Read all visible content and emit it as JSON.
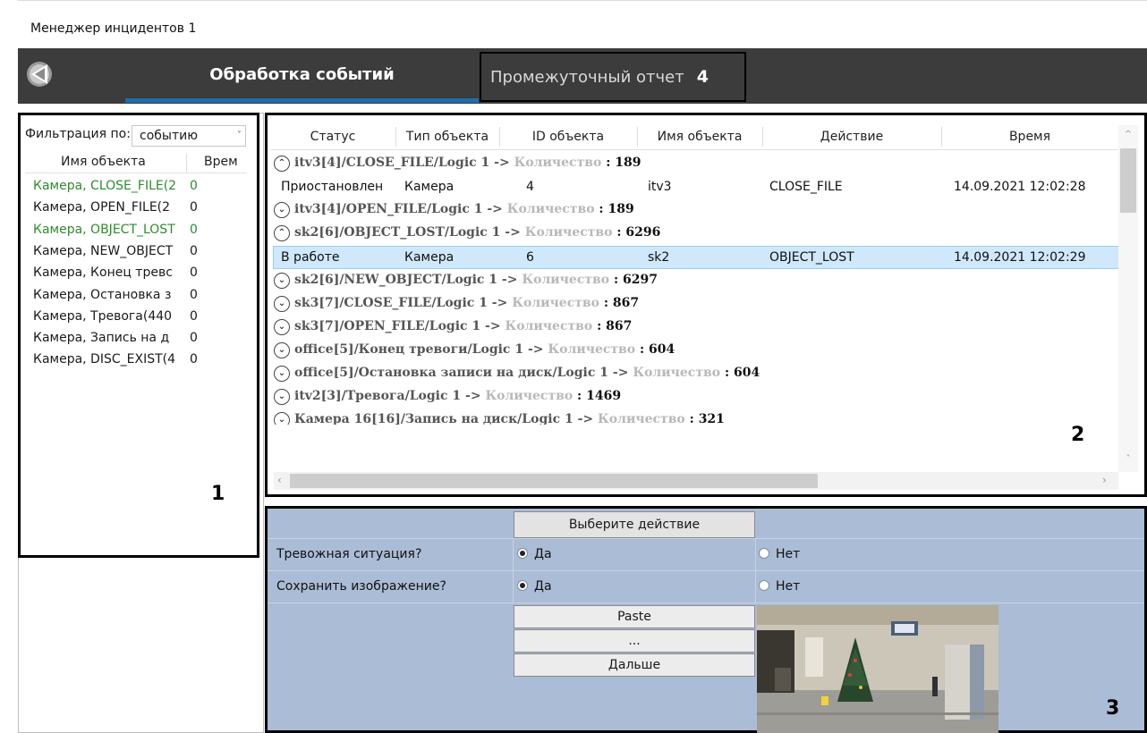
{
  "window": {
    "title": "Менеджер инцидентов 1"
  },
  "tabs": [
    {
      "label": "Обработка событий",
      "active": true
    },
    {
      "label": "Промежуточный отчет",
      "marker": "4",
      "active": false
    }
  ],
  "filter": {
    "label": "Фильтрация по:",
    "selected": "событию",
    "columns": [
      "Имя объекта",
      "Врем"
    ],
    "rows": [
      {
        "name": "Камера, CLOSE_FILE(2",
        "value": "0",
        "highlight": true
      },
      {
        "name": "Камера, OPEN_FILE(2",
        "value": "0",
        "highlight": false
      },
      {
        "name": "Камера, OBJECT_LOST",
        "value": "0",
        "highlight": true
      },
      {
        "name": "Камера, NEW_OBJECT",
        "value": "0",
        "highlight": false
      },
      {
        "name": "Камера, Конец тревс",
        "value": "0",
        "highlight": false
      },
      {
        "name": "Камера, Остановка з",
        "value": "0",
        "highlight": false
      },
      {
        "name": "Камера, Тревога(440",
        "value": "0",
        "highlight": false
      },
      {
        "name": "Камера, Запись на д",
        "value": "0",
        "highlight": false
      },
      {
        "name": "Камера, DISC_EXIST(4",
        "value": "0",
        "highlight": false
      }
    ],
    "marker": "1"
  },
  "events": {
    "columns": [
      "Статус",
      "Тип объекта",
      "ID объекта",
      "Имя объекта",
      "Действие",
      "Время"
    ],
    "count_label": "Количество",
    "groups": [
      {
        "title": "itv3[4]/CLOSE_FILE/Logic 1",
        "count": "189",
        "expanded": true
      },
      {
        "title": "itv3[4]/OPEN_FILE/Logic 1",
        "count": "189",
        "expanded": false
      },
      {
        "title": "sk2[6]/OBJECT_LOST/Logic 1",
        "count": "6296",
        "expanded": true
      },
      {
        "title": "sk2[6]/NEW_OBJECT/Logic 1",
        "count": "6297",
        "expanded": false
      },
      {
        "title": "sk3[7]/CLOSE_FILE/Logic 1",
        "count": "867",
        "expanded": false
      },
      {
        "title": "sk3[7]/OPEN_FILE/Logic 1",
        "count": "867",
        "expanded": false
      },
      {
        "title": "office[5]/Конец тревоги/Logic 1",
        "count": "604",
        "expanded": false
      },
      {
        "title": "office[5]/Остановка записи на диск/Logic 1",
        "count": "604",
        "expanded": false
      },
      {
        "title": "itv2[3]/Тревога/Logic 1",
        "count": "1469",
        "expanded": false
      },
      {
        "title": "Камера 16[16]/Запись на диск/Logic 1",
        "count": "321",
        "expanded": false
      }
    ],
    "rows": [
      {
        "status": "Приостановлен",
        "type": "Камера",
        "id": "4",
        "name": "itv3",
        "action": "CLOSE_FILE",
        "time": "14.09.2021 12:02:28",
        "selected": false
      },
      {
        "status": "В работе",
        "type": "Камера",
        "id": "6",
        "name": "sk2",
        "action": "OBJECT_LOST",
        "time": "14.09.2021 12:02:29",
        "selected": true
      }
    ],
    "marker": "2"
  },
  "form": {
    "choose_action": "Выберите действие",
    "questions": [
      {
        "label": "Тревожная ситуация?",
        "yes": "Да",
        "no": "Нет",
        "value": "yes"
      },
      {
        "label": "Сохранить изображение?",
        "yes": "Да",
        "no": "Нет",
        "value": "yes"
      }
    ],
    "buttons": [
      "Paste",
      "...",
      "Дальше"
    ],
    "marker": "3"
  },
  "colors": {
    "tabbar": "#3c3c3c",
    "tab_active_underline": "#1b6fb0",
    "highlight_text": "#2e8b2e",
    "selected_row": "#cfe8fb",
    "form_bg": "#aabcd6"
  },
  "icons": [
    "app-logo-icon",
    "expand-up-icon",
    "expand-down-icon",
    "dropdown-arrow-icon"
  ]
}
